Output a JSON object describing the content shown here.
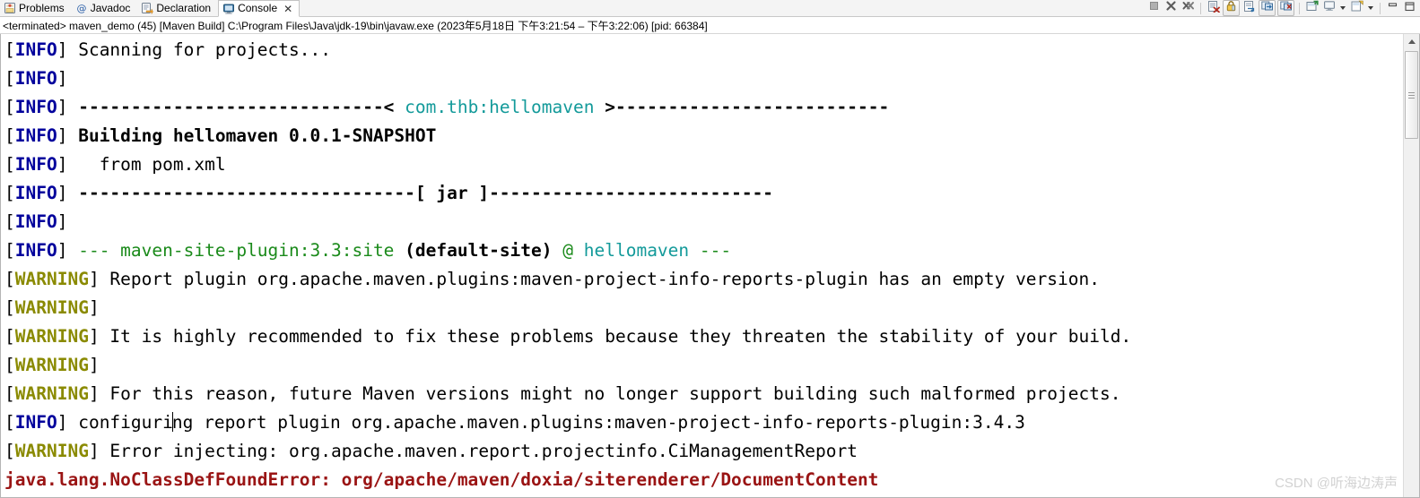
{
  "window": {
    "tabs": [
      {
        "label": "Problems",
        "icon": "problems-icon",
        "active": false
      },
      {
        "label": "Javadoc",
        "icon": "javadoc-icon",
        "active": false
      },
      {
        "label": "Declaration",
        "icon": "declaration-icon",
        "active": false
      },
      {
        "label": "Console",
        "icon": "console-icon",
        "active": true,
        "close": "✕"
      }
    ],
    "toolbar": [
      {
        "name": "terminate-button",
        "icon": "stop-square-icon"
      },
      {
        "name": "remove-launch-button",
        "icon": "x-icon"
      },
      {
        "name": "remove-all-terminated-button",
        "icon": "double-x-icon"
      },
      {
        "name": "clear-console-button",
        "icon": "clear-console-icon"
      },
      {
        "name": "scroll-lock-button",
        "icon": "lock-icon"
      },
      {
        "name": "word-wrap-button",
        "icon": "word-wrap-icon"
      },
      {
        "name": "show-console-on-output-button",
        "icon": "show-console-icon"
      },
      {
        "name": "show-console-on-error-button",
        "icon": "show-console-error-icon"
      },
      {
        "name": "pin-console-button",
        "icon": "pin-console-icon"
      },
      {
        "name": "display-selected-console-button",
        "icon": "display-console-icon"
      },
      {
        "name": "display-selected-console-dropdown",
        "icon": "chevron-down-icon"
      },
      {
        "name": "open-console-button",
        "icon": "new-console-icon"
      },
      {
        "name": "open-console-dropdown",
        "icon": "chevron-down-icon"
      },
      {
        "name": "minimize-button",
        "icon": "minimize-icon"
      },
      {
        "name": "maximize-button",
        "icon": "maximize-icon"
      }
    ]
  },
  "launch": {
    "text": "<terminated> maven_demo (45) [Maven Build] C:\\Program Files\\Java\\jdk-19\\bin\\javaw.exe  (2023年5月18日 下午3:21:54 – 下午3:22:06) [pid: 66384]"
  },
  "console": {
    "lines": [
      {
        "level": "INFO",
        "segments": [
          {
            "t": " Scanning for projects...",
            "c": "plain"
          }
        ]
      },
      {
        "level": "INFO",
        "segments": []
      },
      {
        "level": "INFO",
        "segments": [
          {
            "t": " -----------------------------< ",
            "c": "bold"
          },
          {
            "t": "com.thb:hellomaven",
            "c": "teal"
          },
          {
            "t": " >--------------------------",
            "c": "bold"
          }
        ]
      },
      {
        "level": "INFO",
        "segments": [
          {
            "t": " Building hellomaven 0.0.1-SNAPSHOT",
            "c": "bold"
          }
        ]
      },
      {
        "level": "INFO",
        "segments": [
          {
            "t": "   from pom.xml",
            "c": "plain"
          }
        ]
      },
      {
        "level": "INFO",
        "segments": [
          {
            "t": " --------------------------------[ jar ]---------------------------",
            "c": "bold"
          }
        ]
      },
      {
        "level": "INFO",
        "segments": []
      },
      {
        "level": "INFO",
        "segments": [
          {
            "t": " ",
            "c": "plain"
          },
          {
            "t": "--- maven-site-plugin:3.3:site",
            "c": "green"
          },
          {
            "t": " (default-site)",
            "c": "bold"
          },
          {
            "t": " @",
            "c": "green"
          },
          {
            "t": " hellomaven",
            "c": "teal"
          },
          {
            "t": " ---",
            "c": "green"
          }
        ]
      },
      {
        "level": "WARNING",
        "segments": [
          {
            "t": " Report plugin org.apache.maven.plugins:maven-project-info-reports-plugin has an empty version.",
            "c": "plain"
          }
        ]
      },
      {
        "level": "WARNING",
        "segments": []
      },
      {
        "level": "WARNING",
        "segments": [
          {
            "t": " It is highly recommended to fix these problems because they threaten the stability of your build.",
            "c": "plain"
          }
        ]
      },
      {
        "level": "WARNING",
        "segments": []
      },
      {
        "level": "WARNING",
        "segments": [
          {
            "t": " For this reason, future Maven versions might no longer support building such malformed projects.",
            "c": "plain"
          }
        ]
      },
      {
        "level": "INFO",
        "segments": [
          {
            "t": " configuri",
            "c": "plain"
          },
          {
            "t": "|caret|",
            "c": "caret"
          },
          {
            "t": "ng report plugin org.apache.maven.plugins:maven-project-info-reports-plugin:3.4.3",
            "c": "plain"
          }
        ]
      },
      {
        "level": "WARNING",
        "segments": [
          {
            "t": " Error injecting: org.apache.maven.report.projectinfo.CiManagementReport",
            "c": "plain"
          }
        ]
      },
      {
        "level": null,
        "segments": [
          {
            "t": "java.lang.NoClassDefFoundError: org/apache/maven/doxia/siterenderer/DocumentContent",
            "c": "err"
          }
        ]
      }
    ]
  },
  "watermark": {
    "text": "CSDN @听海边涛声"
  },
  "colors": {
    "info": "#00009c",
    "warning": "#8a8a00",
    "error": "#9a1414",
    "teal": "#139a9a",
    "green": "#1a8a1a"
  }
}
